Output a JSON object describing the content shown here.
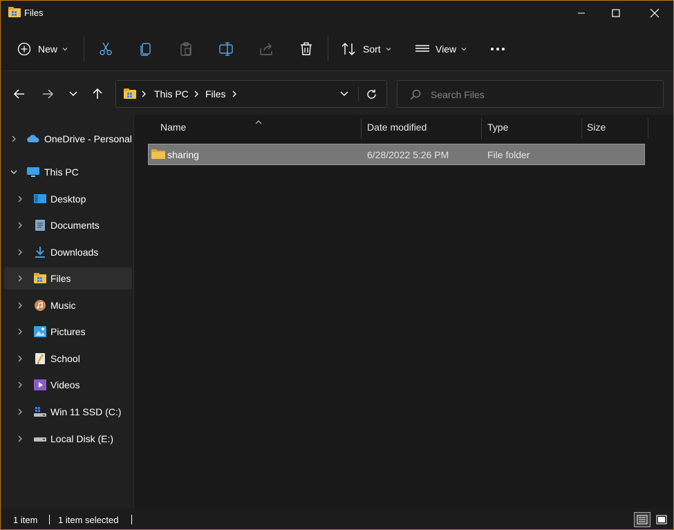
{
  "window": {
    "title": "Files"
  },
  "toolbar": {
    "new_label": "New",
    "sort_label": "Sort",
    "view_label": "View"
  },
  "address": {
    "parts": [
      "This PC",
      "Files"
    ]
  },
  "search": {
    "placeholder": "Search Files"
  },
  "sidebar": {
    "items": [
      {
        "label": "OneDrive - Personal",
        "icon": "onedrive-icon"
      },
      {
        "label": "This PC",
        "icon": "this-pc-icon"
      },
      {
        "label": "Desktop",
        "icon": "desktop-icon"
      },
      {
        "label": "Documents",
        "icon": "documents-icon"
      },
      {
        "label": "Downloads",
        "icon": "downloads-icon"
      },
      {
        "label": "Files",
        "icon": "files-folder-icon"
      },
      {
        "label": "Music",
        "icon": "music-icon"
      },
      {
        "label": "Pictures",
        "icon": "pictures-icon"
      },
      {
        "label": "School",
        "icon": "school-icon"
      },
      {
        "label": "Videos",
        "icon": "videos-icon"
      },
      {
        "label": "Win 11 SSD (C:)",
        "icon": "drive-c-icon"
      },
      {
        "label": "Local Disk (E:)",
        "icon": "drive-e-icon"
      }
    ]
  },
  "columns": {
    "name": "Name",
    "date": "Date modified",
    "type": "Type",
    "size": "Size"
  },
  "files": [
    {
      "name": "sharing",
      "date": "6/28/2022 5:26 PM",
      "type": "File folder",
      "size": ""
    }
  ],
  "status": {
    "count": "1 item",
    "selected": "1 item selected"
  },
  "colors": {
    "accent_border": "#c07a1a",
    "folder_yellow": "#f2c14e",
    "selection": "#777777"
  }
}
